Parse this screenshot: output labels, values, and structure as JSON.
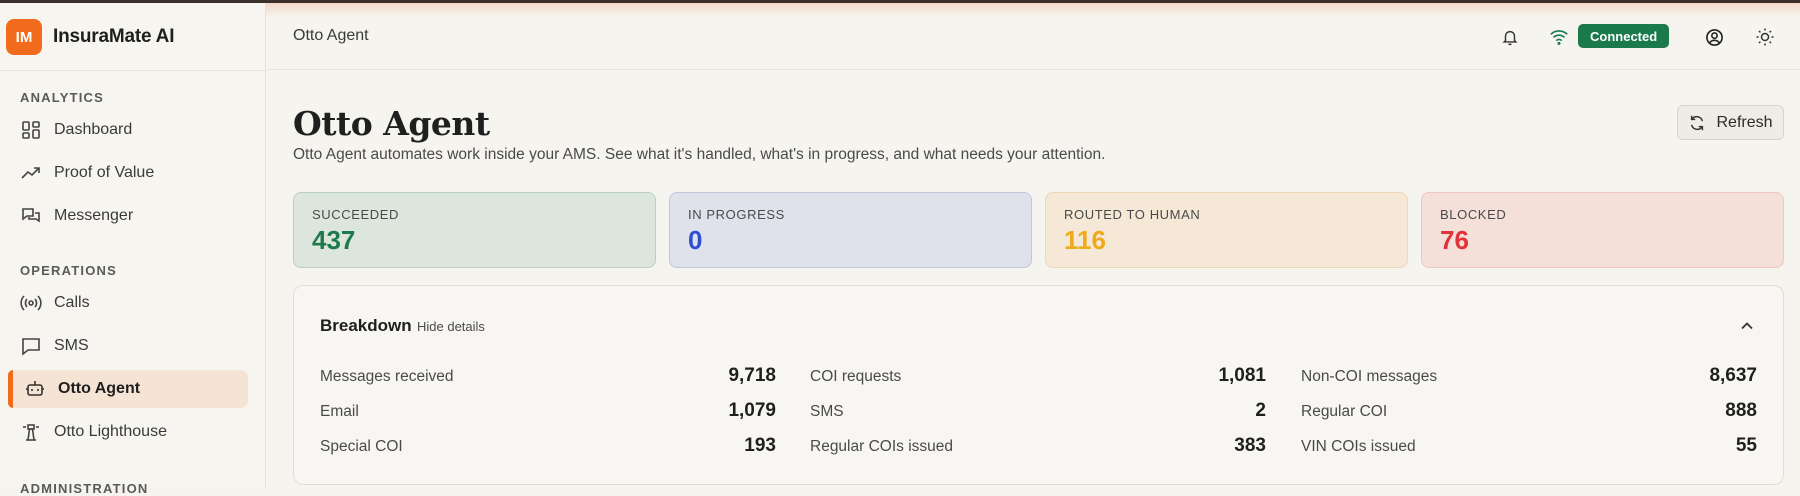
{
  "brand": {
    "logo_text": "IM",
    "name": "InsuraMate AI",
    "accent": "#f26a1b"
  },
  "sidebar": {
    "sections": [
      {
        "label": "ANALYTICS"
      },
      {
        "label": "OPERATIONS"
      },
      {
        "label": "ADMINISTRATION"
      }
    ],
    "items": [
      {
        "label": "Dashboard",
        "icon": "dashboard-icon"
      },
      {
        "label": "Proof of Value",
        "icon": "trending-up-icon"
      },
      {
        "label": "Messenger",
        "icon": "messages-icon"
      },
      {
        "label": "Calls",
        "icon": "broadcast-icon"
      },
      {
        "label": "SMS",
        "icon": "message-square-icon"
      },
      {
        "label": "Otto Agent",
        "icon": "robot-icon",
        "active": true
      },
      {
        "label": "Otto Lighthouse",
        "icon": "lighthouse-icon"
      }
    ]
  },
  "header": {
    "title": "Otto Agent",
    "status": {
      "label": "Connected",
      "color": "#1a7a4c"
    },
    "icons": [
      "bell-icon",
      "wifi-icon",
      "user-circle-icon",
      "sun-icon"
    ]
  },
  "main": {
    "title": "Otto Agent",
    "subtitle": "Otto Agent automates work inside your AMS. See what it's handled, what's in progress, and what needs your attention.",
    "refresh_label": "Refresh",
    "stats": [
      {
        "label": "SUCCEEDED",
        "value": "437",
        "color": "#1e7a4d"
      },
      {
        "label": "IN PROGRESS",
        "value": "0",
        "color": "#2f4fd0"
      },
      {
        "label": "ROUTED TO HUMAN",
        "value": "116",
        "color": "#efaa1a"
      },
      {
        "label": "BLOCKED",
        "value": "76",
        "color": "#e0333a"
      }
    ],
    "breakdown": {
      "title": "Breakdown",
      "toggle_label": "Hide details",
      "rows": [
        {
          "label": "Messages received",
          "value": "9,718"
        },
        {
          "label": "COI requests",
          "value": "1,081"
        },
        {
          "label": "Non-COI messages",
          "value": "8,637"
        },
        {
          "label": "Email",
          "value": "1,079"
        },
        {
          "label": "SMS",
          "value": "2"
        },
        {
          "label": "Regular COI",
          "value": "888"
        },
        {
          "label": "Special COI",
          "value": "193"
        },
        {
          "label": "Regular COIs issued",
          "value": "383"
        },
        {
          "label": "VIN COIs issued",
          "value": "55"
        }
      ]
    }
  }
}
